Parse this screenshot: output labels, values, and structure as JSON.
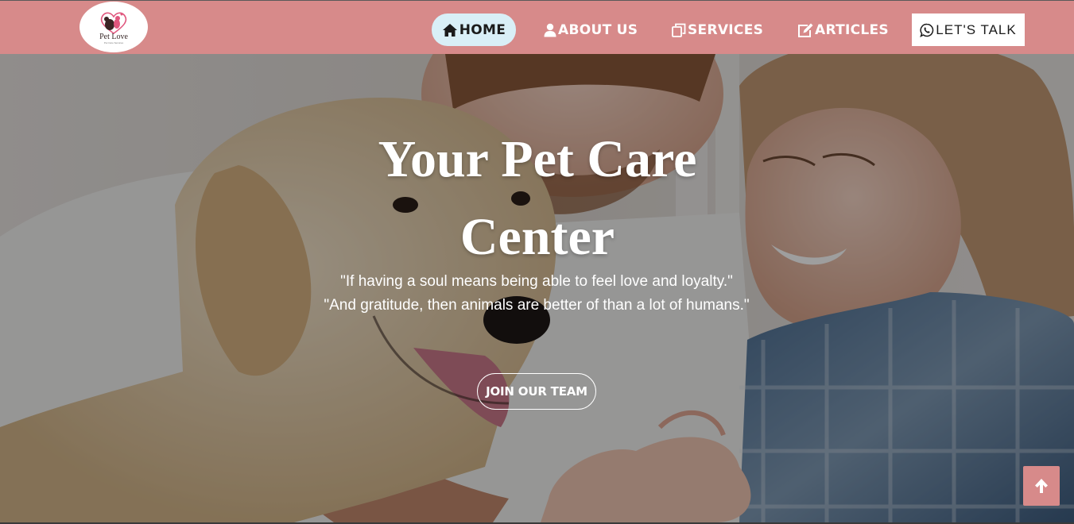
{
  "brand": {
    "logo_text": "Pet Love",
    "logo_tagline": "Pet Care Services",
    "nav_color": "#d78a8a",
    "active_pill_color": "#d9eff7"
  },
  "nav": {
    "items": [
      {
        "label": "HOME",
        "icon": "home-icon"
      },
      {
        "label": "ABOUT US",
        "icon": "user-icon"
      },
      {
        "label": "SERVICES",
        "icon": "copy-icon"
      },
      {
        "label": "ARTICLES",
        "icon": "edit-icon"
      }
    ],
    "cta": {
      "label": "LET'S TALK",
      "icon": "whatsapp-icon"
    }
  },
  "hero": {
    "title_line1": "Your Pet Care",
    "title_line2": "Center",
    "quote_line1": "\"If having a soul means being able to feel love and loyalty.\"",
    "quote_line2": "\"And gratitude, then animals are better of than a lot of humans.\"",
    "button_label": "JOIN OUR TEAM"
  },
  "back_to_top": {
    "icon": "arrow-up-icon"
  }
}
